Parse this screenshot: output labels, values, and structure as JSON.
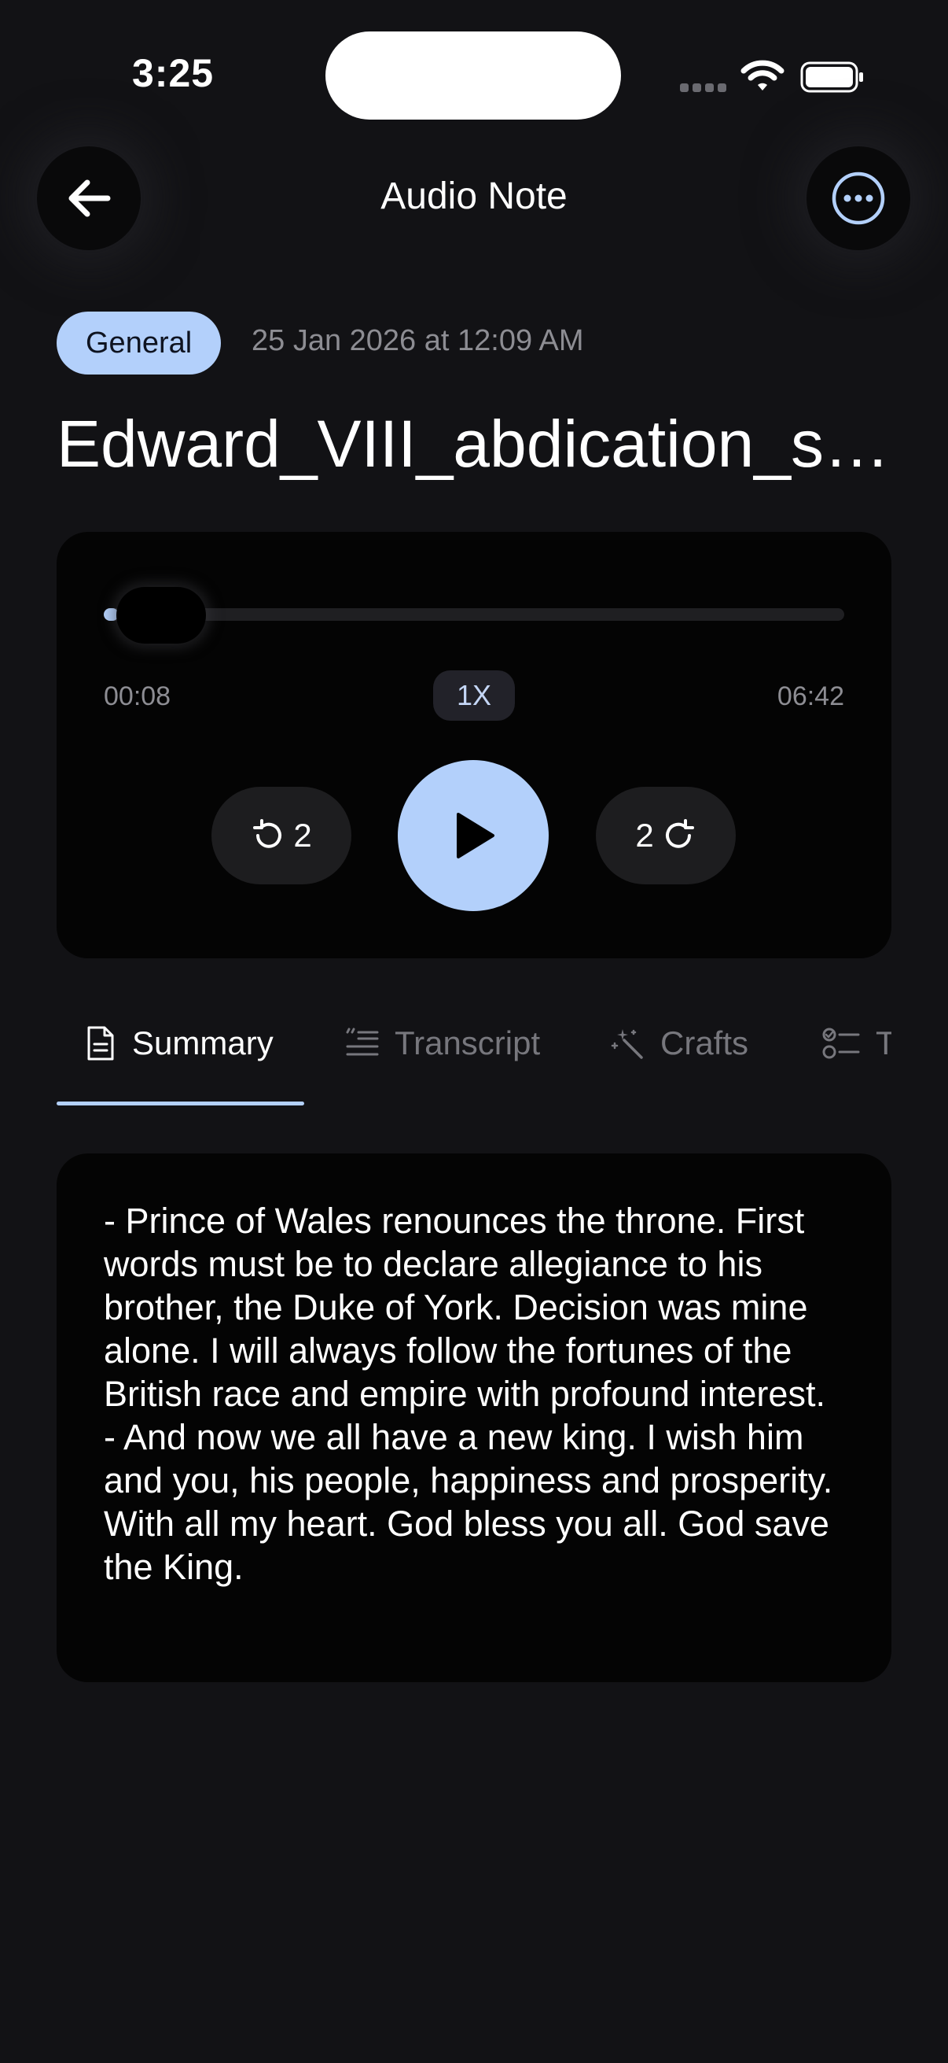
{
  "status_bar": {
    "time": "3:25"
  },
  "header": {
    "title": "Audio Note",
    "back_icon": "arrow-left-icon",
    "more_icon": "more-horizontal-circle-icon"
  },
  "note": {
    "category": "General",
    "date": "25 Jan 2026 at 12:09 AM",
    "title": "Edward_VIII_abdication_speech"
  },
  "player": {
    "elapsed": "00:08",
    "total": "06:42",
    "progress_fraction": 0.02,
    "speed": "1X",
    "skip_back_seconds": "2",
    "skip_forward_seconds": "2",
    "play_icon": "play-icon"
  },
  "tabs": [
    {
      "label": "Summary",
      "icon": "document-icon",
      "active": true
    },
    {
      "label": "Transcript",
      "icon": "transcript-icon",
      "active": false
    },
    {
      "label": "Crafts",
      "icon": "magic-wand-icon",
      "active": false
    },
    {
      "label": "T",
      "icon": "checklist-icon",
      "active": false
    }
  ],
  "summary": {
    "text": "- Prince of Wales renounces the throne. First words must be to declare allegiance to his brother, the Duke of York. Decision was mine alone. I will always follow the fortunes of the British race and empire with profound interest.\n- And now we all have a new king. I wish him and you, his people, happiness and prosperity. With all my heart. God bless you all. God save the King."
  },
  "colors": {
    "background": "#121215",
    "accent": "#b3d0fb",
    "card": "#040404",
    "muted_text": "#8d8d93"
  }
}
